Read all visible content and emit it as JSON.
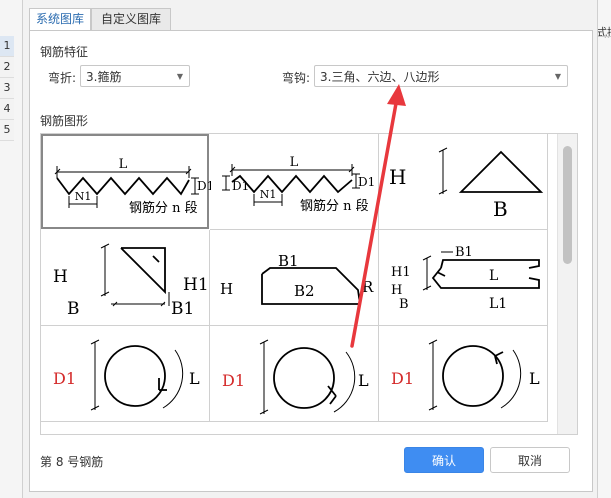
{
  "background": {
    "row_numbers": [
      "1",
      "2",
      "3",
      "4",
      "5"
    ],
    "right_fragment": "式描"
  },
  "tabs": [
    {
      "label": "系统图库",
      "active": true
    },
    {
      "label": "自定义图库",
      "active": false
    }
  ],
  "features": {
    "section_title": "钢筋特征",
    "bend_label": "弯折:",
    "bend_value": "3.箍筋",
    "hook_label": "弯钩:",
    "hook_value": "3.三角、六边、八边形"
  },
  "shapes": {
    "section_title": "钢筋图形",
    "cells": [
      {
        "labels": {
          "l": "L",
          "d1": "D1",
          "n1": "N1",
          "note": "钢筋分 n 段"
        }
      },
      {
        "labels": {
          "l": "L",
          "d1a": "D1",
          "d1b": "D1",
          "n1": "N1",
          "note": "钢筋分 n 段"
        }
      },
      {
        "labels": {
          "h": "H",
          "b": "B"
        }
      },
      {
        "labels": {
          "h": "H",
          "b": "B",
          "h1": "H1",
          "b1": "B1"
        }
      },
      {
        "labels": {
          "b1": "B1",
          "h": "H",
          "b2": "B2",
          "r": "R"
        }
      },
      {
        "labels": {
          "h1": "H1",
          "h": "H",
          "b": "B",
          "b1": "B1",
          "l": "L",
          "l1": "L1"
        }
      },
      {
        "labels": {
          "d1": "D1",
          "l": "L"
        }
      },
      {
        "labels": {
          "d1": "D1",
          "l": "L"
        }
      },
      {
        "labels": {
          "d1": "D1",
          "l": "L"
        }
      }
    ]
  },
  "status_text": "第 8 号钢筋",
  "buttons": {
    "ok": "确认",
    "cancel": "取消"
  },
  "colors": {
    "primary": "#3f8df2",
    "annotation_arrow": "#e8383d",
    "d1_label": "#d42a2a"
  }
}
